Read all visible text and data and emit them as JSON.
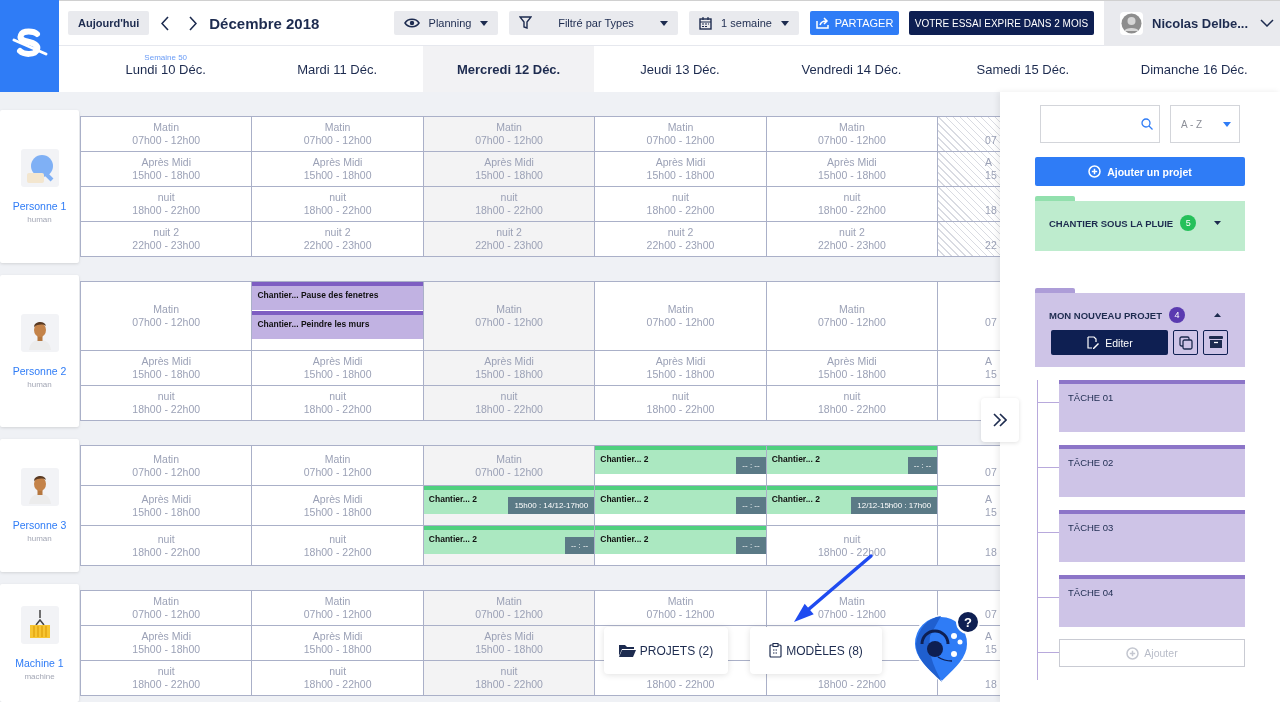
{
  "toolbar": {
    "today": "Aujourd'hui",
    "month": "Décembre 2018",
    "dropdowns": [
      {
        "kind": "view",
        "label": "Planning"
      },
      {
        "kind": "filter",
        "label": "Filtré par Types"
      },
      {
        "kind": "period",
        "label": "1 semaine"
      }
    ],
    "share": "PARTAGER",
    "trial": "VOTRE ESSAI EXPIRE DANS 2 MOIS",
    "user": "Nicolas Delbe..."
  },
  "days": [
    {
      "label": "Lundi 10 Déc.",
      "week": "Semaine 50",
      "selected": false
    },
    {
      "label": "Mardi 11 Déc.",
      "selected": false
    },
    {
      "label": "Mercredi 12 Déc.",
      "selected": true
    },
    {
      "label": "Jeudi 13 Déc.",
      "selected": false
    },
    {
      "label": "Vendredi 14 Déc.",
      "selected": false
    },
    {
      "label": "Samedi 15 Déc.",
      "selected": false
    },
    {
      "label": "Dimanche 16 Déc.",
      "selected": false
    }
  ],
  "groups": [
    {
      "name": "Personne 1",
      "type": "human",
      "kind": "bot",
      "rows": [
        {
          "cells": [
            {
              "slot": "Matin",
              "hours": "07h00 - 12h00"
            },
            {
              "slot": "Matin",
              "hours": "07h00 - 12h00"
            },
            {
              "slot": "Matin",
              "hours": "07h00 - 12h00"
            },
            {
              "slot": "Matin",
              "hours": "07h00 - 12h00"
            },
            {
              "slot": "Matin",
              "hours": "07h00 - 12h00"
            }
          ],
          "edge": {
            "hours": "07",
            "hatched": true
          }
        },
        {
          "cells": [
            {
              "slot": "Après Midi",
              "hours": "15h00 - 18h00"
            },
            {
              "slot": "Après Midi",
              "hours": "15h00 - 18h00"
            },
            {
              "slot": "Après Midi",
              "hours": "15h00 - 18h00"
            },
            {
              "slot": "Après Midi",
              "hours": "15h00 - 18h00"
            },
            {
              "slot": "Après Midi",
              "hours": "15h00 - 18h00"
            }
          ],
          "edge": {
            "slot": "A",
            "hours": "15",
            "hatched": true
          }
        },
        {
          "cells": [
            {
              "slot": "nuit",
              "hours": "18h00 - 22h00"
            },
            {
              "slot": "nuit",
              "hours": "18h00 - 22h00"
            },
            {
              "slot": "nuit",
              "hours": "18h00 - 22h00"
            },
            {
              "slot": "nuit",
              "hours": "18h00 - 22h00"
            },
            {
              "slot": "nuit",
              "hours": "18h00 - 22h00"
            }
          ],
          "edge": {
            "hours": "18",
            "hatched": true
          }
        },
        {
          "cells": [
            {
              "slot": "nuit 2",
              "hours": "22h00 - 23h00"
            },
            {
              "slot": "nuit 2",
              "hours": "22h00 - 23h00"
            },
            {
              "slot": "nuit 2",
              "hours": "22h00 - 23h00"
            },
            {
              "slot": "nuit 2",
              "hours": "22h00 - 23h00"
            },
            {
              "slot": "nuit 2",
              "hours": "22h00 - 23h00"
            }
          ],
          "edge": {
            "hours": "22",
            "hatched": true
          }
        }
      ]
    },
    {
      "name": "Personne 2",
      "type": "human",
      "kind": "person",
      "rows": [
        {
          "cells": [
            {
              "slot": "Matin",
              "hours": "07h00 - 12h00"
            },
            {
              "events": [
                {
                  "label": "Chantier... Pause des fenetres",
                  "color": "#7e5ec2"
                },
                {
                  "label": "Chantier... Peindre les murs",
                  "color": "#7e5ec2"
                }
              ]
            },
            {
              "slot": "Matin",
              "hours": "07h00 - 12h00"
            },
            {
              "slot": "Matin",
              "hours": "07h00 - 12h00"
            },
            {
              "slot": "Matin",
              "hours": "07h00 - 12h00"
            }
          ],
          "edge": {
            "hours": "07",
            "hatched": false
          }
        },
        {
          "cells": [
            {
              "slot": "Après Midi",
              "hours": "15h00 - 18h00"
            },
            {
              "slot": "Après Midi",
              "hours": "15h00 - 18h00"
            },
            {
              "slot": "Après Midi",
              "hours": "15h00 - 18h00"
            },
            {
              "slot": "Après Midi",
              "hours": "15h00 - 18h00"
            },
            {
              "slot": "Après Midi",
              "hours": "15h00 - 18h00"
            }
          ],
          "edge": {
            "slot": "A",
            "hours": "15",
            "hatched": false
          }
        },
        {
          "cells": [
            {
              "slot": "nuit",
              "hours": "18h00 - 22h00"
            },
            {
              "slot": "nuit",
              "hours": "18h00 - 22h00"
            },
            {
              "slot": "nuit",
              "hours": "18h00 - 22h00"
            },
            {
              "slot": "nuit",
              "hours": "18h00 - 22h00"
            },
            {
              "slot": "nuit",
              "hours": "18h00 - 22h00"
            }
          ],
          "edge": {
            "hatched": false
          }
        }
      ]
    },
    {
      "name": "Personne 3",
      "type": "human",
      "kind": "person",
      "rows": [
        {
          "cells": [
            {
              "slot": "Matin",
              "hours": "07h00 - 12h00"
            },
            {
              "slot": "Matin",
              "hours": "07h00 - 12h00"
            },
            {
              "slot": "Matin",
              "hours": "07h00 - 12h00"
            },
            {
              "events": [
                {
                  "label": "Chantier... 2",
                  "time": "-- : --",
                  "color": "#4fd07e"
                }
              ]
            },
            {
              "events": [
                {
                  "label": "Chantier... 2",
                  "time": "-- : --",
                  "color": "#4fd07e"
                }
              ]
            }
          ],
          "edge": {
            "hours": "07",
            "hatched": false
          }
        },
        {
          "cells": [
            {
              "slot": "Après Midi",
              "hours": "15h00 - 18h00"
            },
            {
              "slot": "Après Midi",
              "hours": "15h00 - 18h00"
            },
            {
              "events": [
                {
                  "label": "Chantier... 2",
                  "time": "15h00 : 14/12-17h00",
                  "color": "#4fd07e"
                }
              ]
            },
            {
              "events": [
                {
                  "label": "Chantier... 2",
                  "time": "-- : --",
                  "color": "#4fd07e"
                }
              ]
            },
            {
              "events": [
                {
                  "label": "Chantier... 2",
                  "time": "12/12-15h00 : 17h00",
                  "color": "#4fd07e"
                }
              ]
            }
          ],
          "edge": {
            "slot": "A",
            "hours": "15",
            "hatched": false
          }
        },
        {
          "cells": [
            {
              "slot": "nuit",
              "hours": "18h00 - 22h00"
            },
            {
              "slot": "nuit",
              "hours": "18h00 - 22h00"
            },
            {
              "events": [
                {
                  "label": "Chantier... 2",
                  "time": "-- : --",
                  "color": "#4fd07e"
                }
              ]
            },
            {
              "events": [
                {
                  "label": "Chantier... 2",
                  "time": "-- : --",
                  "color": "#4fd07e"
                }
              ]
            },
            {
              "slot": "nuit",
              "hours": "18h00 - 22h00"
            }
          ],
          "edge": {
            "hours": "18",
            "hatched": false
          }
        }
      ]
    },
    {
      "name": "Machine 1",
      "type": "machine",
      "kind": "machine",
      "rows": [
        {
          "cells": [
            {
              "slot": "Matin",
              "hours": "07h00 - 12h00"
            },
            {
              "slot": "Matin",
              "hours": "07h00 - 12h00"
            },
            {
              "slot": "Matin",
              "hours": "07h00 - 12h00"
            },
            {
              "slot": "Matin",
              "hours": "07h00 - 12h00"
            },
            {
              "slot": "Matin",
              "hours": "07h00 - 12h00"
            }
          ],
          "edge": {
            "hours": "07",
            "hatched": false
          }
        },
        {
          "cells": [
            {
              "slot": "Après Midi",
              "hours": "15h00 - 18h00"
            },
            {
              "slot": "Après Midi",
              "hours": "15h00 - 18h00"
            },
            {
              "slot": "Après Midi",
              "hours": "15h00 - 18h00"
            },
            {},
            {}
          ],
          "edge": {
            "slot": "A",
            "hours": "15",
            "hatched": false
          }
        },
        {
          "cells": [
            {
              "slot": "nuit",
              "hours": "18h00 - 22h00"
            },
            {
              "slot": "nuit",
              "hours": "18h00 - 22h00"
            },
            {
              "slot": "nuit",
              "hours": "18h00 - 22h00"
            },
            {
              "hours": "18h00 - 22h00"
            },
            {
              "hours": "18h00 - 22h00"
            }
          ],
          "edge": {
            "hours": "18",
            "hatched": false
          }
        }
      ]
    }
  ],
  "panel": {
    "sort": "A - Z",
    "add_project": "Ajouter un projet",
    "projects": [
      {
        "title": "CHANTIER SOUS LA PLUIE",
        "count": "5",
        "color": "#25c05a",
        "expanded": false
      },
      {
        "title": "MON NOUVEAU PROJET",
        "count": "4",
        "color": "#5a3ab0",
        "expanded": true,
        "edit": "Editer",
        "tasks": [
          "TÂCHE 01",
          "TÂCHE 02",
          "TÂCHE 03",
          "TÂCHE 04"
        ],
        "add_task": "Ajouter"
      }
    ]
  },
  "bottom_buttons": [
    {
      "kind": "folder",
      "label": "PROJETS (2)"
    },
    {
      "kind": "clipboard",
      "label": "MODÈLES (8)"
    }
  ],
  "help_badge": "?"
}
